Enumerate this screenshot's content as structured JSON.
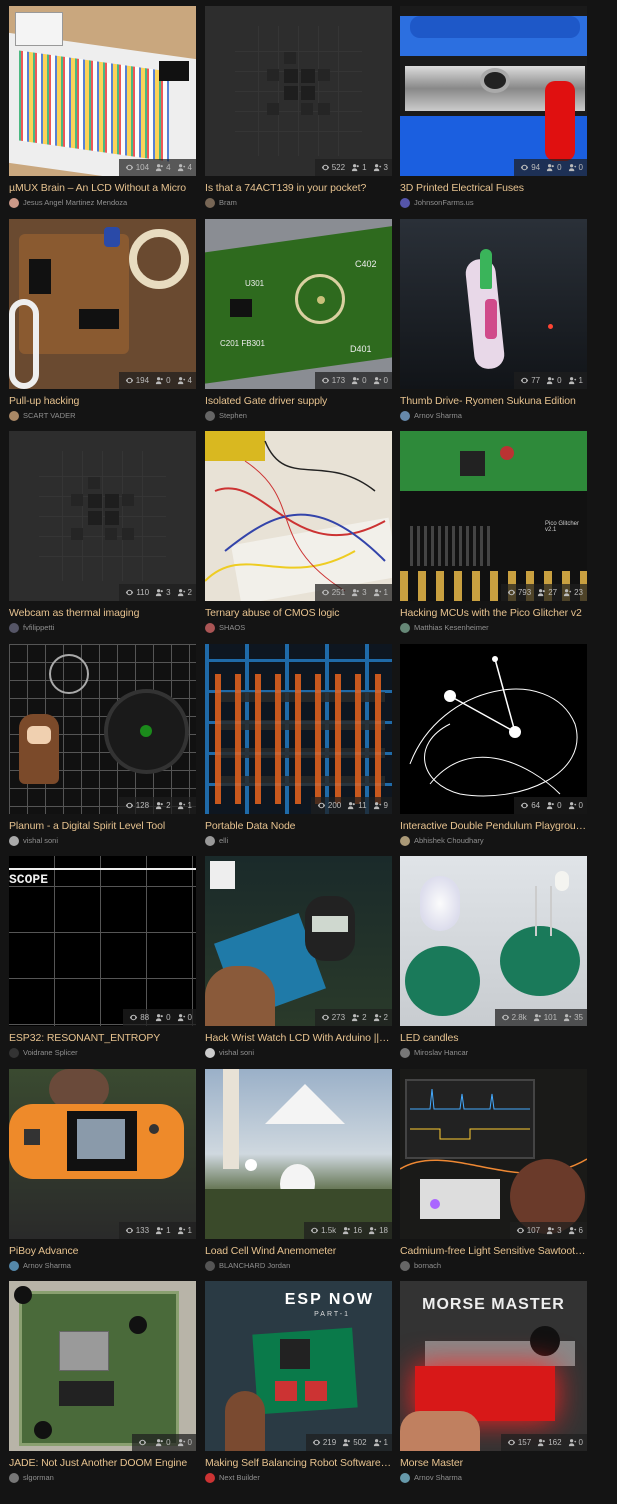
{
  "colors": {
    "background": "#141414",
    "title": "#e6c28f",
    "author": "#8f8f8f"
  },
  "cards": [
    {
      "title": "µMUX Brain – An LCD Without a Micro",
      "author": "Jesus Angel Martinez Mendoza",
      "views": "104",
      "likes": "4",
      "followers": "4",
      "art": "breadboard-box"
    },
    {
      "title": "Is that a 74ACT139 in your pocket?",
      "author": "Bram",
      "views": "522",
      "likes": "1",
      "followers": "3",
      "art": "placeholder"
    },
    {
      "title": "3D Printed Electrical Fuses",
      "author": "JohnsonFarms.us",
      "views": "94",
      "likes": "0",
      "followers": "0",
      "art": "blue-fuse"
    },
    {
      "title": "Pull-up hacking",
      "author": "SCART VADER",
      "views": "194",
      "likes": "0",
      "followers": "4",
      "art": "perfboard"
    },
    {
      "title": "Isolated Gate driver supply",
      "author": "Stephen",
      "views": "173",
      "likes": "0",
      "followers": "0",
      "art": "green-pcb"
    },
    {
      "title": "Thumb Drive- Ryomen Sukuna Edition",
      "author": "Arnov Sharma",
      "views": "77",
      "likes": "0",
      "followers": "1",
      "art": "thumb-drive"
    },
    {
      "title": "Webcam as thermal imaging",
      "author": "fvfilippetti",
      "views": "110",
      "likes": "3",
      "followers": "2",
      "art": "placeholder"
    },
    {
      "title": "Ternary abuse of CMOS logic",
      "author": "SHAOS",
      "views": "251",
      "likes": "3",
      "followers": "1",
      "art": "wires"
    },
    {
      "title": "Hacking MCUs with the Pico Glitcher v2",
      "author": "Matthias Kesenheimer",
      "views": "793",
      "likes": "27",
      "followers": "23",
      "art": "pico"
    },
    {
      "title": "Planum - a Digital Spirit Level Tool",
      "author": "vishal soni",
      "views": "128",
      "likes": "2",
      "followers": "1",
      "art": "planum"
    },
    {
      "title": "Portable Data Node",
      "author": "elli",
      "views": "200",
      "likes": "11",
      "followers": "9",
      "art": "datanode"
    },
    {
      "title": "Interactive Double Pendulum Playground",
      "author": "Abhishek Choudhary",
      "views": "64",
      "likes": "0",
      "followers": "0",
      "art": "pendulum"
    },
    {
      "title": "ESP32: RESONANT_ENTROPY",
      "author": "Voidrane Splicer",
      "views": "88",
      "likes": "0",
      "followers": "0",
      "art": "scope"
    },
    {
      "title": "Hack Wrist Watch LCD With Arduino || …",
      "author": "vishal soni",
      "views": "273",
      "likes": "2",
      "followers": "2",
      "art": "arduino"
    },
    {
      "title": "LED candles",
      "author": "Miroslav Hancar",
      "views": "2.8k",
      "likes": "101",
      "followers": "35",
      "art": "candles"
    },
    {
      "title": "PiBoy Advance",
      "author": "Arnov Sharma",
      "views": "133",
      "likes": "1",
      "followers": "1",
      "art": "gameboy"
    },
    {
      "title": "Load Cell Wind Anemometer",
      "author": "BLANCHARD Jordan",
      "views": "1.5k",
      "likes": "16",
      "followers": "18",
      "art": "anemometer"
    },
    {
      "title": "Cadmium-free Light Sensitive Sawtooth…",
      "author": "bornach",
      "views": "107",
      "likes": "3",
      "followers": "6",
      "art": "sawtooth"
    },
    {
      "title": "JADE: Not Just Another DOOM Engine",
      "author": "slgorman",
      "views": "",
      "likes": "0",
      "followers": "0",
      "art": "cpu"
    },
    {
      "title": "Making Self Balancing Robot Software …",
      "author": "Next Builder",
      "views": "219",
      "likes": "502",
      "followers": "1",
      "art": "espnow",
      "art_text": {
        "headline": "ESP NOW",
        "sub": "PART-1"
      }
    },
    {
      "title": "Morse Master",
      "author": "Arnov Sharma",
      "views": "157",
      "likes": "162",
      "followers": "0",
      "art": "morse",
      "art_text": {
        "headline": "MORSE MASTER"
      }
    }
  ]
}
